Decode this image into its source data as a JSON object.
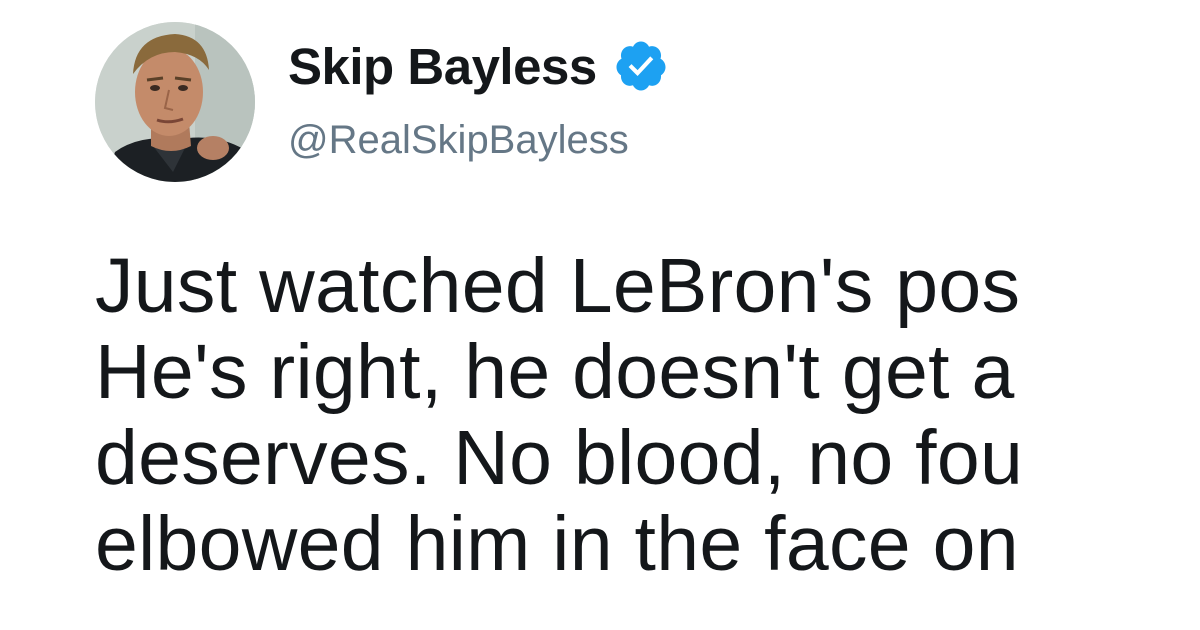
{
  "tweet": {
    "author": {
      "display_name": "Skip Bayless",
      "handle": "@RealSkipBayless",
      "verified": true,
      "avatar_icon": "profile-photo",
      "verified_icon": "verified-badge-icon",
      "verified_color": "#1da1f2"
    },
    "text_lines": [
      "Just watched LeBron's pos",
      "He's right, he doesn't get a",
      "deserves. No blood, no fou",
      "elbowed him in the face on"
    ]
  }
}
